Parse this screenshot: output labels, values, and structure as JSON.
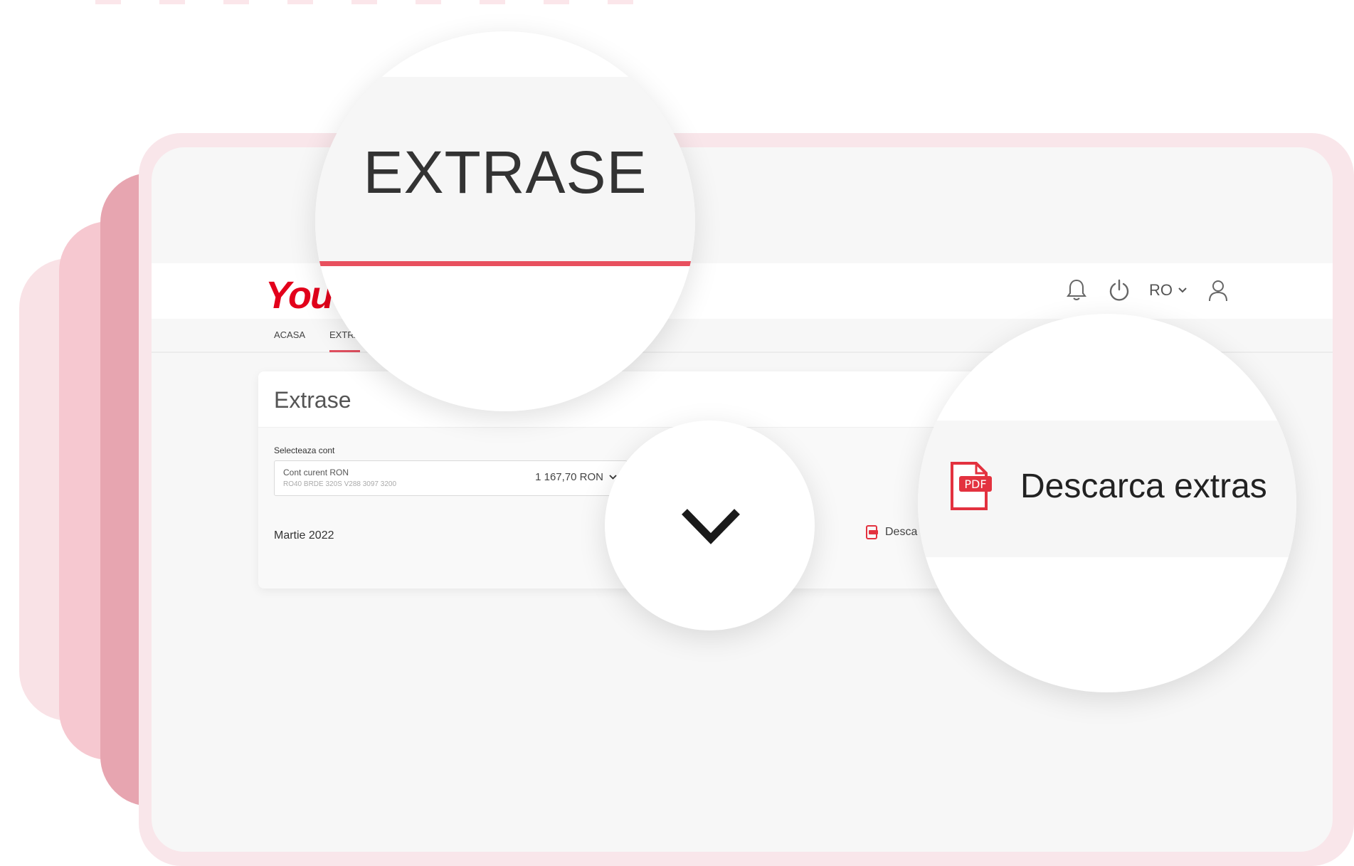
{
  "app": {
    "logo_text": "You"
  },
  "header": {
    "icons": [
      "bell-icon",
      "power-icon",
      "user-icon"
    ],
    "language": "RO"
  },
  "nav": {
    "tabs": [
      {
        "label": "ACASA"
      },
      {
        "label": "EXTRA"
      }
    ]
  },
  "card": {
    "title": "Extrase",
    "select_label": "Selecteaza cont",
    "account": {
      "name": "Cont curent RON",
      "iban": "RO40 BRDE 320S V288 3097 3200",
      "balance": "1 167,70 RON"
    },
    "statement": {
      "month": "Martie 2022",
      "download_label": "Desca"
    }
  },
  "magnifiers": {
    "tab_label": "EXTRASE",
    "download_label": "Descarca extras",
    "pdf_badge": "PDF"
  },
  "colors": {
    "brand_red": "#e3001b",
    "accent_underline": "#e8505e",
    "pdf_red": "#e3323f"
  }
}
